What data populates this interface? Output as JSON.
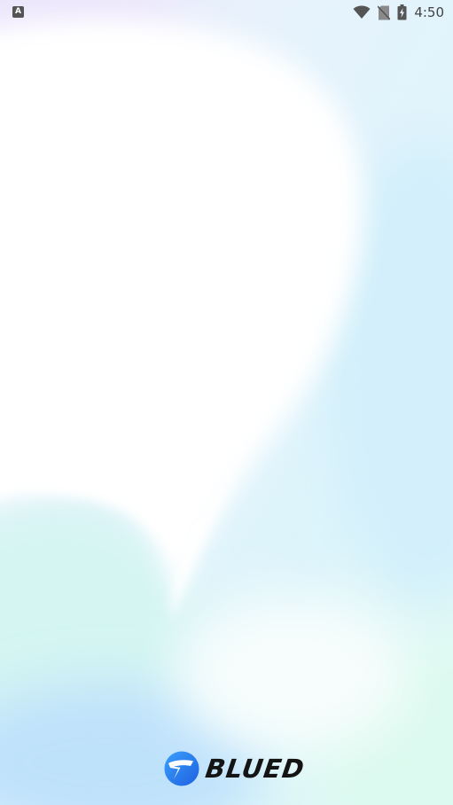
{
  "status_bar": {
    "notification_icon": "a-keyboard-icon",
    "notification_glyph": "A",
    "wifi_icon": "wifi-icon",
    "sim_icon": "no-sim-icon",
    "battery_icon": "battery-charging-icon",
    "time": "4:50"
  },
  "brand": {
    "logo_icon": "blued-logo-icon",
    "name": "BLUED",
    "colors": {
      "logo_blue": "#2f8df6",
      "logo_deep": "#1e5fe0",
      "text": "#141414"
    }
  },
  "background": {
    "colors": {
      "base": "#dff3fb",
      "white": "#ffffff",
      "lavender": "#ece8fb",
      "mint": "#d9f8ee",
      "sky": "#bfe6fb"
    }
  }
}
